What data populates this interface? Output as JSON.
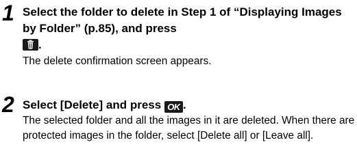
{
  "steps": [
    {
      "number": "1",
      "heading_part1": "Select the folder to delete in Step 1 of “Displaying Images by Folder” (p.85), and press",
      "heading_key_icon": "trash-key-icon",
      "heading_part2": ".",
      "body": "The delete confirmation screen appears."
    },
    {
      "number": "2",
      "heading_part1": "Select [Delete] and press",
      "heading_key_label": "OK",
      "heading_part2": ".",
      "body": "The selected folder and all the images in it are deleted. When there are protected images in the folder, select [Delete all] or [Leave all]."
    }
  ]
}
